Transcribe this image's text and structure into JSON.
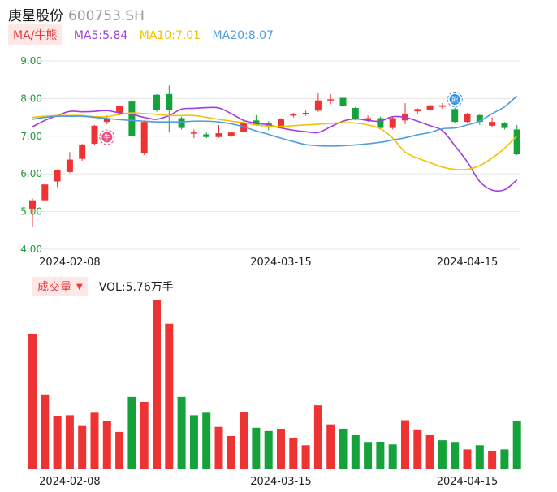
{
  "header": {
    "stock_name": "庚星股份",
    "stock_code": "600753.SH"
  },
  "ma_legend": {
    "tag": "MA/牛熊",
    "items": [
      {
        "label": "MA5:5.84",
        "color": "#a23ce0"
      },
      {
        "label": "MA10:7.01",
        "color": "#f2c200"
      },
      {
        "label": "MA20:8.07",
        "color": "#4d9de0"
      }
    ]
  },
  "volume_legend": {
    "tag": "成交量",
    "label": "VOL:5.76万手"
  },
  "colors": {
    "up": "#ee3333",
    "down": "#16a23a",
    "grid": "#e6e6e6"
  },
  "markers": [
    {
      "icon": "bull-bear-bear-icon",
      "text": "牛",
      "index": 6,
      "color": "#ee4c7c"
    },
    {
      "icon": "bull-bear-bull-icon",
      "text": "熊",
      "index": 34,
      "color": "#2a8ee8"
    }
  ],
  "chart_data": [
    {
      "type": "candlestick",
      "y_ticks": [
        "9.00",
        "8.00",
        "7.00",
        "6.00",
        "5.00",
        "4.00"
      ],
      "ylim": [
        4.0,
        9.0
      ],
      "x_ticks": [
        {
          "index": 3,
          "label": "2024-02-08"
        },
        {
          "index": 20,
          "label": "2024-03-15"
        },
        {
          "index": 35,
          "label": "2024-04-15"
        }
      ],
      "candles": [
        {
          "o": 5.08,
          "c": 5.3,
          "h": 5.35,
          "l": 4.6
        },
        {
          "o": 5.3,
          "c": 5.72,
          "h": 5.75,
          "l": 5.28
        },
        {
          "o": 5.8,
          "c": 6.1,
          "h": 6.12,
          "l": 5.65
        },
        {
          "o": 6.05,
          "c": 6.38,
          "h": 6.58,
          "l": 6.02
        },
        {
          "o": 6.4,
          "c": 6.78,
          "h": 6.8,
          "l": 6.35
        },
        {
          "o": 6.8,
          "c": 7.28,
          "h": 7.3,
          "l": 6.78
        },
        {
          "o": 7.38,
          "c": 7.48,
          "h": 7.55,
          "l": 7.32
        },
        {
          "o": 7.62,
          "c": 7.8,
          "h": 7.82,
          "l": 7.55
        },
        {
          "o": 7.92,
          "c": 7.0,
          "h": 8.02,
          "l": 6.98
        },
        {
          "o": 6.55,
          "c": 7.38,
          "h": 7.42,
          "l": 6.5
        },
        {
          "o": 8.1,
          "c": 7.7,
          "h": 8.12,
          "l": 7.65
        },
        {
          "o": 8.12,
          "c": 7.7,
          "h": 8.35,
          "l": 7.1
        },
        {
          "o": 7.48,
          "c": 7.22,
          "h": 7.52,
          "l": 7.18
        },
        {
          "o": 7.08,
          "c": 7.1,
          "h": 7.18,
          "l": 6.95
        },
        {
          "o": 7.05,
          "c": 6.98,
          "h": 7.1,
          "l": 6.95
        },
        {
          "o": 6.98,
          "c": 7.08,
          "h": 7.3,
          "l": 6.96
        },
        {
          "o": 7.0,
          "c": 7.1,
          "h": 7.12,
          "l": 6.98
        },
        {
          "o": 7.12,
          "c": 7.36,
          "h": 7.4,
          "l": 7.1
        },
        {
          "o": 7.42,
          "c": 7.3,
          "h": 7.56,
          "l": 7.28
        },
        {
          "o": 7.35,
          "c": 7.28,
          "h": 7.4,
          "l": 7.16
        },
        {
          "o": 7.25,
          "c": 7.45,
          "h": 7.48,
          "l": 7.22
        },
        {
          "o": 7.55,
          "c": 7.58,
          "h": 7.62,
          "l": 7.5
        },
        {
          "o": 7.62,
          "c": 7.58,
          "h": 7.68,
          "l": 7.54
        },
        {
          "o": 7.68,
          "c": 7.95,
          "h": 8.15,
          "l": 7.65
        },
        {
          "o": 7.95,
          "c": 7.98,
          "h": 8.12,
          "l": 7.85
        },
        {
          "o": 8.02,
          "c": 7.8,
          "h": 8.05,
          "l": 7.72
        },
        {
          "o": 7.75,
          "c": 7.45,
          "h": 7.78,
          "l": 7.42
        },
        {
          "o": 7.42,
          "c": 7.48,
          "h": 7.55,
          "l": 7.38
        },
        {
          "o": 7.48,
          "c": 7.22,
          "h": 7.52,
          "l": 7.18
        },
        {
          "o": 7.22,
          "c": 7.48,
          "h": 7.52,
          "l": 7.18
        },
        {
          "o": 7.42,
          "c": 7.6,
          "h": 7.88,
          "l": 7.32
        },
        {
          "o": 7.66,
          "c": 7.72,
          "h": 7.74,
          "l": 7.6
        },
        {
          "o": 7.7,
          "c": 7.82,
          "h": 7.86,
          "l": 7.65
        },
        {
          "o": 7.78,
          "c": 7.82,
          "h": 7.88,
          "l": 7.72
        },
        {
          "o": 7.72,
          "c": 7.38,
          "h": 7.76,
          "l": 7.34
        },
        {
          "o": 7.38,
          "c": 7.6,
          "h": 7.62,
          "l": 7.36
        },
        {
          "o": 7.56,
          "c": 7.38,
          "h": 7.58,
          "l": 7.3
        },
        {
          "o": 7.28,
          "c": 7.38,
          "h": 7.5,
          "l": 7.24
        },
        {
          "o": 7.35,
          "c": 7.22,
          "h": 7.38,
          "l": 7.18
        },
        {
          "o": 7.18,
          "c": 6.52,
          "h": 7.3,
          "l": 6.5
        }
      ],
      "ma5": [
        7.25,
        7.42,
        7.55,
        7.66,
        7.65,
        7.66,
        7.68,
        7.62,
        7.58,
        7.5,
        7.45,
        7.55,
        7.72,
        7.74,
        7.76,
        7.75,
        7.6,
        7.42,
        7.35,
        7.3,
        7.22,
        7.16,
        7.12,
        7.1,
        7.25,
        7.4,
        7.46,
        7.42,
        7.4,
        7.52,
        7.5,
        7.4,
        7.28,
        7.15,
        6.75,
        6.32,
        5.8,
        5.57,
        5.58,
        5.84
      ],
      "ma10": [
        7.5,
        7.53,
        7.55,
        7.55,
        7.55,
        7.52,
        7.52,
        7.58,
        7.62,
        7.6,
        7.58,
        7.55,
        7.55,
        7.55,
        7.5,
        7.45,
        7.4,
        7.36,
        7.3,
        7.27,
        7.26,
        7.28,
        7.3,
        7.32,
        7.34,
        7.36,
        7.35,
        7.3,
        7.2,
        6.95,
        6.58,
        6.42,
        6.3,
        6.18,
        6.12,
        6.12,
        6.22,
        6.42,
        6.68,
        7.01
      ],
      "ma20": [
        7.45,
        7.5,
        7.53,
        7.53,
        7.53,
        7.5,
        7.47,
        7.44,
        7.42,
        7.4,
        7.38,
        7.38,
        7.38,
        7.4,
        7.4,
        7.38,
        7.33,
        7.25,
        7.14,
        7.05,
        6.95,
        6.86,
        6.78,
        6.75,
        6.74,
        6.75,
        6.77,
        6.8,
        6.84,
        6.9,
        6.96,
        7.04,
        7.1,
        7.2,
        7.22,
        7.3,
        7.4,
        7.6,
        7.78,
        8.07
      ]
    },
    {
      "type": "bar",
      "title": "VOL",
      "unit": "万手",
      "values": [
        16.2,
        9.0,
        6.4,
        6.5,
        5.2,
        6.8,
        5.8,
        4.5,
        8.7,
        8.1,
        20.3,
        17.5,
        8.7,
        6.5,
        6.8,
        5.1,
        4.0,
        6.9,
        5.0,
        4.6,
        4.8,
        3.8,
        2.9,
        7.7,
        5.4,
        4.8,
        4.1,
        3.2,
        3.3,
        3.0,
        5.9,
        4.7,
        4.1,
        3.5,
        3.2,
        2.4,
        2.9,
        2.2,
        2.4,
        5.76
      ],
      "up": [
        true,
        true,
        true,
        true,
        true,
        true,
        true,
        true,
        false,
        true,
        true,
        true,
        false,
        false,
        false,
        true,
        true,
        true,
        false,
        false,
        true,
        true,
        true,
        true,
        true,
        false,
        false,
        false,
        false,
        false,
        true,
        true,
        true,
        false,
        false,
        true,
        false,
        true,
        false,
        false
      ]
    }
  ]
}
